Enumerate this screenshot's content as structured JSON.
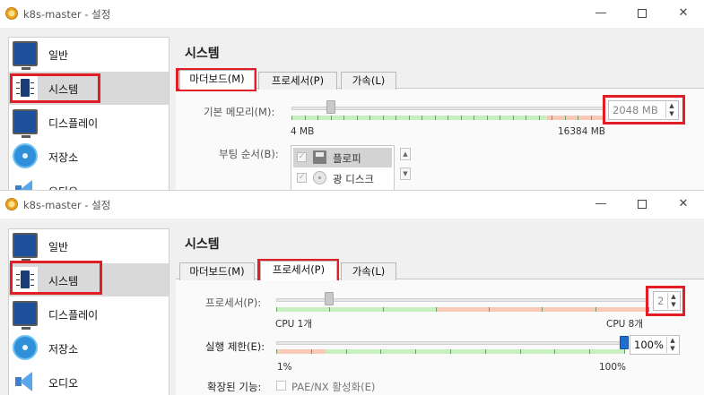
{
  "window_title": "k8s-master - 설정",
  "window_controls": {
    "minimize": "—",
    "maximize": "",
    "close": "✕"
  },
  "sidebar": {
    "items": [
      {
        "label": "일반",
        "icon": "monitor-icon"
      },
      {
        "label": "시스템",
        "icon": "chip-icon"
      },
      {
        "label": "디스플레이",
        "icon": "display-icon"
      },
      {
        "label": "저장소",
        "icon": "storage-disk-icon"
      },
      {
        "label": "오디오",
        "icon": "speaker-icon"
      }
    ],
    "selected": "시스템"
  },
  "section_title": "시스템",
  "tabs": [
    {
      "label": "마더보드(M)"
    },
    {
      "label": "프로세서(P)"
    },
    {
      "label": "가속(L)"
    }
  ],
  "window1": {
    "active_tab": "마더보드(M)",
    "base_memory": {
      "label": "기본 메모리(M):",
      "value": "2048 MB",
      "min_label": "4 MB",
      "max_label": "16384 MB",
      "fraction": 0.125
    },
    "boot_order": {
      "label": "부팅 순서(B):",
      "items": [
        {
          "label": "플로피",
          "checked": true,
          "icon": "floppy-icon"
        },
        {
          "label": "광 디스크",
          "checked": true,
          "icon": "optical-disc-icon"
        }
      ]
    }
  },
  "window2": {
    "active_tab": "프로세서(P)",
    "processors": {
      "label": "프로세서(P):",
      "value": "2",
      "min_label": "CPU 1개",
      "max_label": "CPU 8개",
      "fraction": 0.143
    },
    "execution_cap": {
      "label": "실행 제한(E):",
      "value": "100%",
      "min_label": "1%",
      "max_label": "100%",
      "fraction": 1.0
    },
    "extended_features": {
      "label": "확장된 기능:",
      "checkbox_label": "PAE/NX 활성화(E)",
      "checked": false
    }
  },
  "colors": {
    "highlight_box": "#e21d26",
    "scale_green": "#c8efc0",
    "scale_red": "#f8c9b7",
    "selected_row": "#d9d9d9"
  }
}
